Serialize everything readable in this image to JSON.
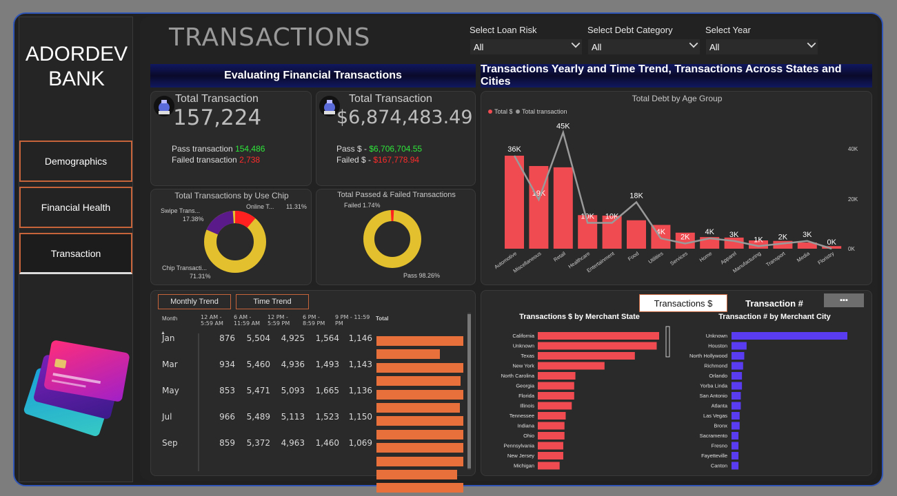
{
  "sidebar": {
    "brand_line1": "ADORDEV",
    "brand_line2": "BANK",
    "nav": [
      "Demographics",
      "Financial Health",
      "Transaction"
    ]
  },
  "header": {
    "title": "TRANSACTIONS",
    "filters": [
      {
        "label": "Select Loan Risk",
        "value": "All"
      },
      {
        "label": "Select Debt Category",
        "value": "All"
      },
      {
        "label": "Select Year",
        "value": "All"
      }
    ]
  },
  "banners": {
    "left": "Evaluating Financial Transactions",
    "right": "Transactions Yearly and Time Trend, Transactions Across States and Cities"
  },
  "kpi_count": {
    "title": "Total Transaction",
    "value": "157,224",
    "pass_label": "Pass transaction",
    "pass_value": "154,486",
    "fail_label": "Failed transaction",
    "fail_value": "2,738"
  },
  "kpi_amount": {
    "title": "Total Transaction",
    "value": "$6,874,483.49",
    "pass_label": "Pass $ -",
    "pass_value": "$6,706,704.55",
    "fail_label": "Failed $ -",
    "fail_value": "$167,778.94"
  },
  "donut_chip": {
    "title": "Total Transactions by Use Chip",
    "labels": [
      "Swipe Trans...",
      "17.38%",
      "Online T...",
      "11.31%",
      "Chip Transacti...",
      "71.31%"
    ]
  },
  "donut_pass": {
    "title": "Total Passed & Failed Transactions",
    "failed_label": "Failed 1.74%",
    "pass_label": "Pass 98.26%"
  },
  "colors": {
    "red": "#f04b50",
    "gold": "#e3c12e",
    "purple": "#5a1a8a",
    "orange": "#e8703a",
    "blue": "#5a3cf0",
    "line": "#9a9a9a"
  },
  "chart_data": [
    {
      "type": "bar",
      "title": "Total Debt by Age Group",
      "legend": [
        "Total $",
        "Total transaction"
      ],
      "categories": [
        "Automotive",
        "Miscellaneous",
        "Retail",
        "Healthcare",
        "Entertainment",
        "Food",
        "Utilities",
        "Services",
        "Home",
        "Apparel",
        "Manufacturing",
        "Transport",
        "Media",
        "Floristry"
      ],
      "series": [
        {
          "name": "Total $",
          "values": [
            36000,
            32000,
            31500,
            13000,
            12800,
            11000,
            9200,
            6200,
            4500,
            4300,
            3200,
            3000,
            2400,
            1000
          ]
        },
        {
          "name": "Total transaction",
          "values": [
            36000,
            19000,
            45000,
            10000,
            10000,
            18000,
            4000,
            2000,
            4000,
            3000,
            1000,
            2000,
            3000,
            0
          ]
        }
      ],
      "data_labels": [
        "36K",
        "19K",
        "45K",
        "10K",
        "10K",
        "18K",
        "4K",
        "2K",
        "4K",
        "3K",
        "1K",
        "2K",
        "3K",
        "0K"
      ],
      "y_ticks": [
        "40K",
        "20K",
        "0K"
      ],
      "ylim": [
        0,
        48000
      ]
    },
    {
      "type": "bar",
      "title": "Transactions $ by Merchant State",
      "categories": [
        "California",
        "Unknown",
        "Texas",
        "New York",
        "North Carolina",
        "Georgia",
        "Florida",
        "Illinois",
        "Tennessee",
        "Indiana",
        "Ohio",
        "Pennsylvania",
        "New Jersey",
        "Michigan"
      ],
      "values": [
        100,
        98,
        80,
        55,
        31,
        30,
        30,
        28,
        23,
        22,
        22,
        21,
        21,
        18
      ]
    },
    {
      "type": "bar",
      "title": "Transaction # by Merchant City",
      "categories": [
        "Unknown",
        "Houston",
        "North Hollywood",
        "Richmond",
        "Orlando",
        "Yorba Linda",
        "San Antonio",
        "Atlanta",
        "Las Vegas",
        "Bronx",
        "Sacramento",
        "Fresno",
        "Fayetteville",
        "Canton"
      ],
      "values": [
        100,
        13,
        11,
        10,
        9,
        9,
        8,
        8,
        7,
        7,
        6,
        6,
        6,
        6
      ]
    }
  ],
  "trend": {
    "tabs": [
      "Monthly Trend",
      "Time Trend"
    ],
    "headers": [
      "Month",
      "12 AM - 5:59 AM",
      "6 AM - 11:59 AM",
      "12 PM - 5:59 PM",
      "6 PM - 8:59 PM",
      "9 PM - 11:59 PM",
      "Total"
    ],
    "rows": [
      {
        "month": "Jan",
        "v": [
          "876",
          "5,504",
          "4,925",
          "1,564",
          "1,146"
        ]
      },
      {
        "month": "Mar",
        "v": [
          "934",
          "5,460",
          "4,936",
          "1,493",
          "1,143"
        ]
      },
      {
        "month": "May",
        "v": [
          "853",
          "5,471",
          "5,093",
          "1,665",
          "1,136"
        ]
      },
      {
        "month": "Jul",
        "v": [
          "966",
          "5,489",
          "5,113",
          "1,523",
          "1,150"
        ]
      },
      {
        "month": "Sep",
        "v": [
          "859",
          "5,372",
          "4,963",
          "1,460",
          "1,069"
        ]
      }
    ],
    "total_bars": [
      100,
      73,
      100,
      97,
      100,
      96,
      100,
      100,
      100,
      100,
      93,
      100,
      2
    ]
  },
  "toggle": {
    "left": "Transactions $",
    "right": "Transaction #",
    "more": "▪▪▪"
  }
}
